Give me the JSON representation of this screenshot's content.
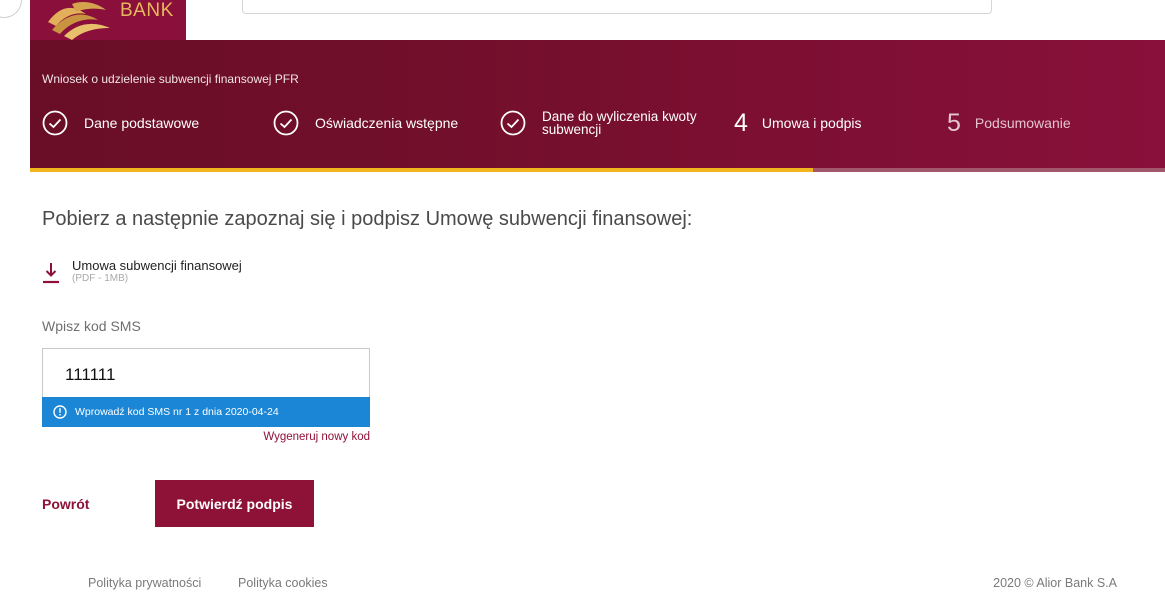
{
  "header": {
    "logo_text": "BANK"
  },
  "banner": {
    "title": "Wniosek o udzielenie subwencji finansowej PFR",
    "steps": [
      {
        "label": "Dane podstawowe",
        "status": "done"
      },
      {
        "label": "Oświadczenia wstępne",
        "status": "done"
      },
      {
        "label_line1": "Dane do wyliczenia kwoty",
        "label_line2": "subwencji",
        "status": "done"
      },
      {
        "number": "4",
        "label": "Umowa i podpis",
        "status": "active"
      },
      {
        "number": "5",
        "label": "Podsumowanie",
        "status": "pending"
      }
    ],
    "progress_fraction": 0.69,
    "progress_color": "#f1b61d"
  },
  "main": {
    "heading": "Pobierz a następnie zapoznaj się i podpisz Umowę subwencji finansowej:",
    "document": {
      "title": "Umowa subwencji finansowej",
      "meta": "(PDF - 1MB)",
      "icon": "download-icon"
    },
    "sms": {
      "label": "Wpisz kod SMS",
      "value": "111111",
      "info": "Wprowadź kod SMS nr 1 z dnia 2020-04-24",
      "info_icon": "info-icon",
      "regenerate": "Wygeneruj nowy kod"
    },
    "back_label": "Powrót",
    "confirm_label": "Potwierdź podpis"
  },
  "footer": {
    "links": [
      "Polityka prywatności",
      "Polityka cookies"
    ],
    "copyright": "2020 © Alior Bank S.A"
  },
  "colors": {
    "brand": "#8e1138",
    "info": "#1b86d6"
  }
}
